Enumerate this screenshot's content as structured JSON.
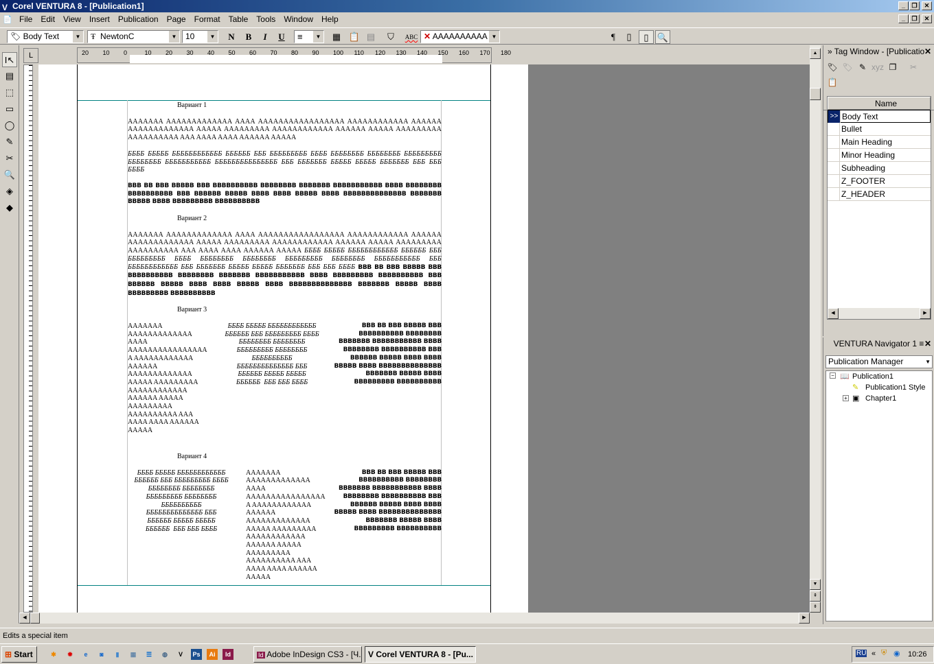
{
  "window": {
    "title": "Corel VENTURA 8 - [Publication1]"
  },
  "menu": [
    "File",
    "Edit",
    "View",
    "Insert",
    "Publication",
    "Page",
    "Format",
    "Table",
    "Tools",
    "Window",
    "Help"
  ],
  "toolbar": {
    "tag": "Body Text",
    "font": "NewtonC",
    "size": "10",
    "normal": "N",
    "bold": "B",
    "italic": "I",
    "underline": "U",
    "find_text": "AAAAAAAAAA"
  },
  "ruler": {
    "ticks": [
      "20",
      "10",
      "0",
      "10",
      "20",
      "30",
      "40",
      "50",
      "60",
      "70",
      "80",
      "90",
      "100",
      "110",
      "120",
      "130",
      "140",
      "150",
      "160",
      "170",
      "180"
    ]
  },
  "document": {
    "v1": {
      "heading": "Вариант 1",
      "a": "AAAAAAA AAAAAAAAAAAAA AAAA AAAAAAAAAAAAAAAAA AAAAAAAAAAAA AAAAAA AAAAAAAAAAAAA AAAAA AAAAAAAAA AAAAAAAAAAAA AAAAAA AAAAA AAAAAAAAA AAAAAAAAAA AAA AAAA AAAA AAAAAA AAAAA",
      "b": "ББББ БББББ ББББББББББББ ББББББ БББ БББББББББ ББББ ББББББББ ББББББББ БББББББББ ББББББББ БББББББББББ БББББББББББББББ БББ БББББББ БББББ БББББ БББББББ БББ БББ ББББ",
      "c": "ВВВ ВВ ВВВ ВВВВВ ВВВ ВВВВВВВВВВ ВВВВВВВВ ВВВВВВВ ВВВВВВВВВВВ ВВВВ ВВВВВВВВ ВВВВВВВВВВ ВВВ ВВВВВВ ВВВВВ ВВВВ ВВВВ ВВВВВ ВВВВ ВВВВВВВВВВВВВВ ВВВВВВВ ВВВВВ ВВВВ ВВВВВВВВВ ВВВВВВВВВВ"
    },
    "v2": {
      "heading": "Вариант 2",
      "a": "AAAAAAA AAAAAAAAAAAAA AAAA AAAAAAAAAAAAAAAAA AAAAAAAAAAAA AAAAAA AAAAAAAAAAAAA AAAAA AAAAAAAAA AAAAAAAAAAAA AAAAAA AAAAA AAAAAAAAA AAAAAAAAAA AAA AAAA AAAA AAAAAA AAAAA ",
      "b": "ББББ БББББ ББББББББББББ ББББББ БББ БББББББББ ББББ ББББББББ ББББББББ БББББББББ ББББББББ БББББББББББ БББ ББББББББББББ БББ БББББББ БББББ БББББ БББББББ БББ БББ ББББ ",
      "c": "ВВВ ВВ ВВВ ВВВВВ ВВВ ВВВВВВВВВВ ВВВВВВВВ ВВВВВВВ ВВВВВВВВВВВ ВВВВ ВВВВВВВВВ ВВВВВВВВВВ ВВВ ВВВВВВ ВВВВВ ВВВВ ВВВВ ВВВВВ ВВВВ ВВВВВВВВВВВВВВ ВВВВВВВ ВВВВВ ВВВВ ВВВВВВВВВ ВВВВВВВВВВ"
    },
    "v3": {
      "heading": "Вариант 3",
      "a": [
        "AAAAAAA",
        "AAAAAAAAAAAAA",
        "AAAA",
        "AAAAAAAAAAAAAAAA",
        "A AAAAAAAAAAAA",
        "AAAAAA",
        "AAAAAAAAAAAAA",
        "AAAAA AAAAAAAAA",
        "AAAAAAAAAAAA",
        "AAAAAA AAAAA",
        "AAAAAAAAA",
        "AAAAAAAAAA AAA",
        "AAAA AAAA AAAAAA",
        "AAAAA"
      ],
      "b": [
        "ББББ БББББ ББББББББББББ",
        "ББББББ БББ БББББББББ ББББ",
        "ББББББББ ББББББББ",
        "БББББББББ ББББББББ",
        "ББББББББББ",
        "ББББББББББББББ БББ",
        "ББББББ БББББ БББББ",
        "ББББББ  БББ БББ ББББ"
      ],
      "c": [
        "ВВВ ВВ ВВВ ВВВВВ ВВВ",
        "ВВВВВВВВВВ ВВВВВВВВ",
        "ВВВВВВВ ВВВВВВВВВВВ ВВВВ",
        "ВВВВВВВВ ВВВВВВВВВВ ВВВ",
        "ВВВВВВ ВВВВВ ВВВВ ВВВВ",
        "ВВВВВ ВВВВ ВВВВВВВВВВВВВВ",
        "ВВВВВВВ ВВВВВ ВВВВ",
        "ВВВВВВВВВ ВВВВВВВВВВ"
      ]
    },
    "v4": {
      "heading": "Вариант 4",
      "b": [
        "ББББ БББББ ББББББББББББ",
        "ББББББ БББ БББББББББ ББББ",
        "ББББББББ ББББББББ",
        "БББББББББ ББББББББ",
        "ББББББББББ",
        "ББББББББББББББ БББ",
        "ББББББ БББББ БББББ",
        "ББББББ  БББ БББ ББББ"
      ],
      "a": [
        "AAAAAAA",
        "AAAAAAAAAAAAA",
        "AAAA",
        "AAAAAAAAAAAAAAAA",
        "A AAAAAAAAAAAA",
        "AAAAAA",
        "AAAAAAAAAAAAA",
        "AAAAA AAAAAAAAA",
        "AAAAAAAAAAAA",
        "AAAAAA AAAAA",
        "AAAAAAAAA",
        "AAAAAAAAAA AAA",
        "AAAA AAAA AAAAAA",
        "AAAAA"
      ],
      "c": [
        "ВВВ ВВ ВВВ ВВВВВ ВВВ",
        "ВВВВВВВВВВ ВВВВВВВВ",
        "ВВВВВВВ ВВВВВВВВВВВ ВВВВ",
        "ВВВВВВВВ ВВВВВВВВВВ ВВВ",
        "ВВВВВВ ВВВВВ ВВВВ ВВВВ",
        "ВВВВВ ВВВВ ВВВВВВВВВВВВВВ",
        "ВВВВВВВ ВВВВВ ВВВВ",
        "ВВВВВВВВВ ВВВВВВВВВВ"
      ]
    }
  },
  "tag_window": {
    "title": "Tag Window - [Publicatio",
    "column": "Name",
    "selected_marker": ">>",
    "tags": [
      "Body Text",
      "Bullet",
      "Main Heading",
      "Minor Heading",
      "Subheading",
      "Z_FOOTER",
      "Z_HEADER"
    ]
  },
  "navigator": {
    "title": "VENTURA Navigator 1",
    "view": "Publication Manager",
    "tree": [
      "Publication1",
      "Publication1 Style",
      "Chapter1"
    ]
  },
  "status": "Edits a special item",
  "taskbar": {
    "start": "Start",
    "quicklaunch": [
      "Ps",
      "Ai",
      "Id"
    ],
    "tasks": [
      "Adobe InDesign CS3 - [Ч...",
      "Corel VENTURA 8 - [Pu..."
    ],
    "lang": "RU",
    "clock": "10:26"
  },
  "colors": {
    "title_start": "#0a246a",
    "margin_line": "#008080",
    "page_bg": "#ffffff",
    "desk": "#808080"
  }
}
